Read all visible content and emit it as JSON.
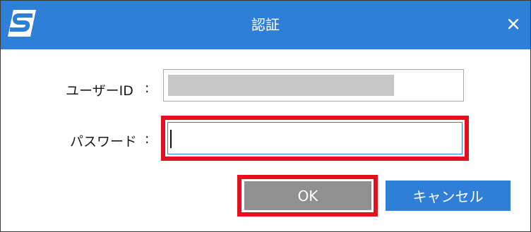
{
  "window": {
    "title": "認証",
    "icon": "scansnap-logo-icon",
    "close_icon": "close-icon"
  },
  "form": {
    "user_id": {
      "label": "ユーザーID",
      "separator": ":",
      "value": ""
    },
    "password": {
      "label": "パスワード",
      "separator": ":",
      "value": ""
    }
  },
  "buttons": {
    "ok_label": "OK",
    "cancel_label": "キャンセル"
  },
  "colors": {
    "titlebar": "#2f7fd8",
    "highlight": "#e60f1e",
    "ok_button": "#909090",
    "cancel_button": "#2f7fd8"
  }
}
